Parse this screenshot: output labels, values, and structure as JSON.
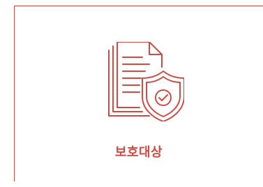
{
  "card": {
    "label": "보호대상",
    "icon": "protected-document-shield-icon",
    "accent_color": "#d24a42"
  }
}
